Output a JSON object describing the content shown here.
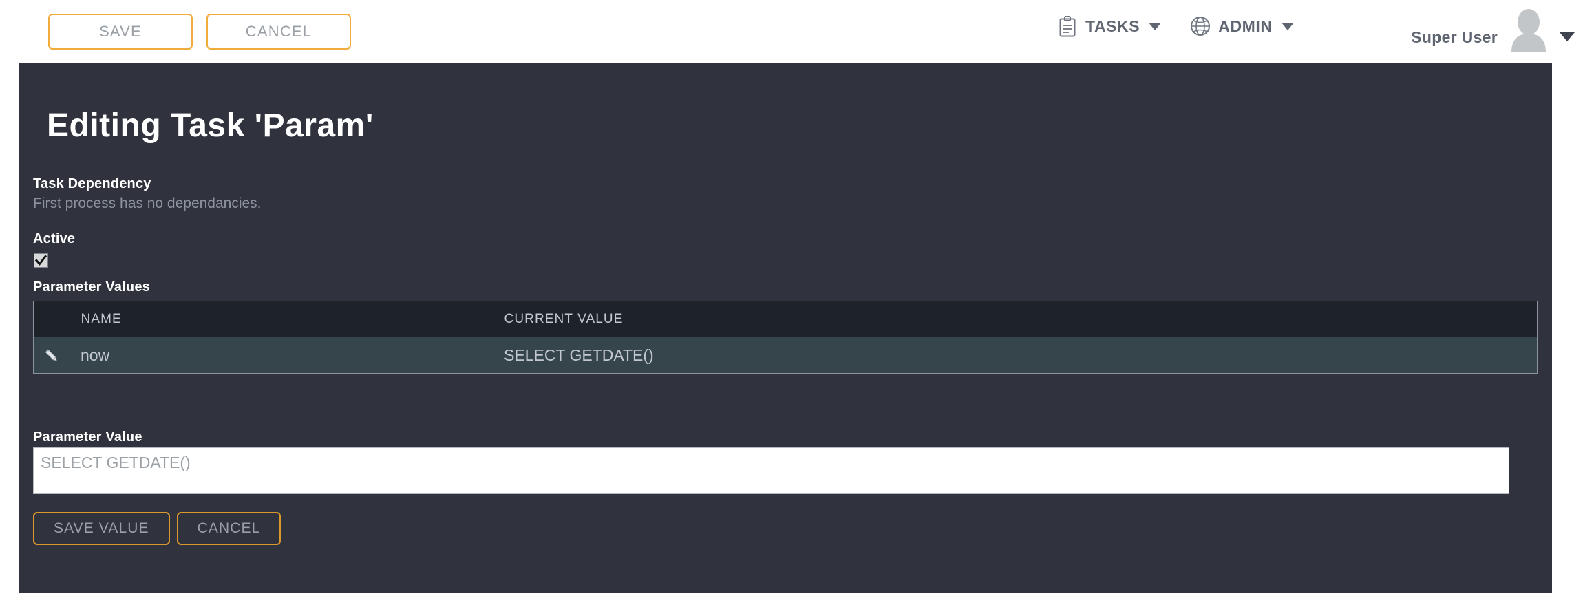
{
  "topbar": {
    "save_label": "SAVE",
    "cancel_label": "CANCEL",
    "nav": [
      {
        "label": "TASKS",
        "icon": "clipboard-icon"
      },
      {
        "label": "ADMIN",
        "icon": "globe-icon"
      }
    ],
    "user_name": "Super User"
  },
  "page": {
    "title": "Editing Task 'Param'"
  },
  "form": {
    "dependency_label": "Task Dependency",
    "dependency_note": "First process has no dependancies.",
    "active_label": "Active",
    "active_checked": true,
    "parameter_values_label": "Parameter Values",
    "parameter_value_label": "Parameter Value",
    "parameter_value_placeholder": "SELECT GETDATE()",
    "parameter_value_text": ""
  },
  "table": {
    "columns": [
      "",
      "NAME",
      "CURRENT VALUE"
    ],
    "rows": [
      {
        "icon": "pencil-icon",
        "name": "now",
        "current_value": "SELECT GETDATE()"
      }
    ]
  },
  "actions": {
    "save_value_label": "SAVE VALUE",
    "cancel_label": "CANCEL"
  },
  "colors": {
    "accent_orange": "#f0ad3e",
    "panel_bg": "#30333d",
    "table_header_bg": "#1e2329",
    "table_row_bg": "#36454c",
    "muted_text": "#8d939e"
  }
}
